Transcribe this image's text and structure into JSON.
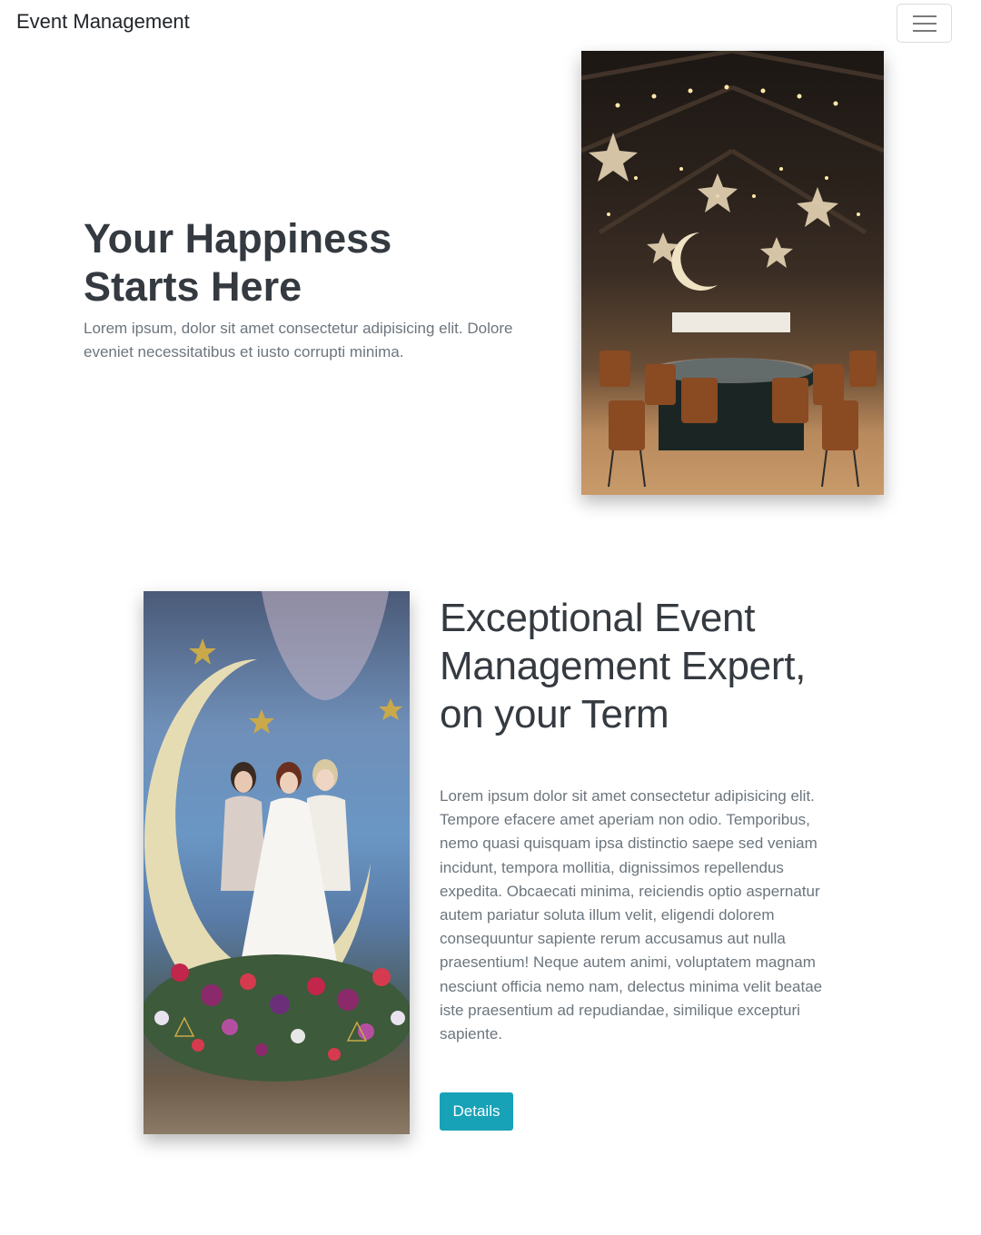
{
  "navbar": {
    "brand": "Event Management",
    "toggler_icon": "hamburger-menu-icon"
  },
  "hero": {
    "title": "Your Happiness Starts Here",
    "text": "Lorem ipsum, dolor sit amet consectetur adipisicing elit. Dolore eveniet necessitatibus et iusto corrupti minima.",
    "image": "wedding-reception-hall-photo"
  },
  "feature": {
    "image": "bridal-party-crescent-moon-photo",
    "title": "Exceptional Event Management Expert, on your Term",
    "text": "Lorem ipsum dolor sit amet consectetur adipisicing elit. Tempore efacere amet aperiam non odio. Temporibus, nemo quasi quisquam ipsa distinctio saepe sed veniam incidunt, tempora mollitia, dignissimos repellendus expedita. Obcaecati minima, reiciendis optio aspernatur autem pariatur soluta illum velit, eligendi dolorem consequuntur sapiente rerum accusamus aut nulla praesentium! Neque autem animi, voluptatem magnam nesciunt officia nemo nam, delectus minima velit beatae iste praesentium ad repudiandae, similique excepturi sapiente.",
    "button_label": "Details"
  },
  "colors": {
    "primary_button": "#17a2b8",
    "heading": "#343a40",
    "muted_text": "#6c757d"
  }
}
